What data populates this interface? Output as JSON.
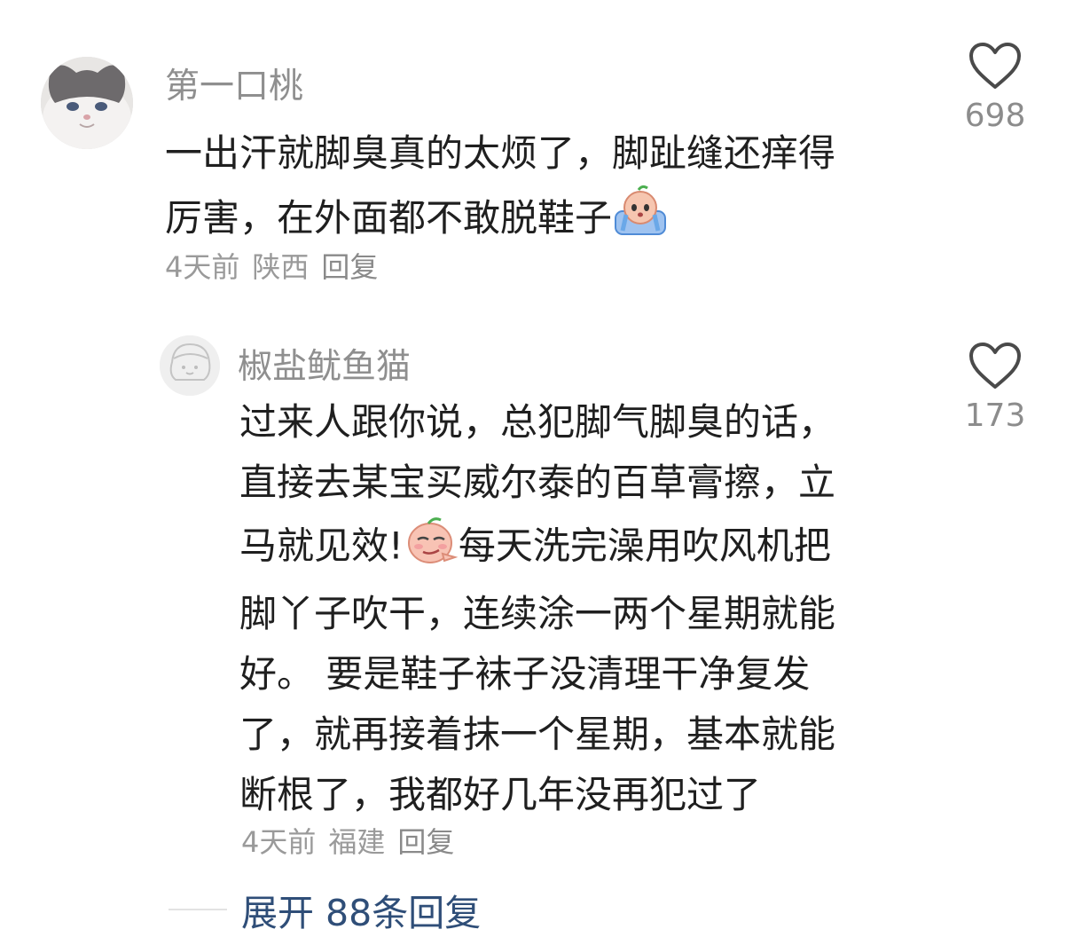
{
  "comments": [
    {
      "username": "第一口桃",
      "avatar_icon": "cat-avatar",
      "text_lines": [
        "一出汗就脚臭真的太烦了，脚趾缝还痒得",
        "厉害，在外面都不敢脱鞋子"
      ],
      "emoji": "crying-peach-emoji",
      "time": "4天前",
      "location": "陕西",
      "reply_label": "回复",
      "likes": "698",
      "like_icon": "heart-outline-icon"
    },
    {
      "username": "椒盐鱿鱼猫",
      "avatar_icon": "sketch-avatar",
      "text_lines": [
        "过来人跟你说，总犯脚气脚臭的话，",
        "直接去某宝买威尔泰的百草膏擦，立",
        "马就见效!",
        "每天洗完澡用吹风机把",
        "脚丫子吹干，连续涂一两个星期就能",
        "好。 要是鞋子袜子没清理干净复发",
        "了，就再接着抹一个星期，基本就能",
        "断根了，我都好几年没再犯过了"
      ],
      "emoji": "smug-peach-emoji",
      "time": "4天前",
      "location": "福建",
      "reply_label": "回复",
      "likes": "173",
      "like_icon": "heart-outline-icon"
    }
  ],
  "expand_replies": "展开 88条回复",
  "colors": {
    "text": "#1f1f1f",
    "username": "#8f8f8f",
    "meta": "#9a9a9a",
    "link": "#2f4e78"
  }
}
